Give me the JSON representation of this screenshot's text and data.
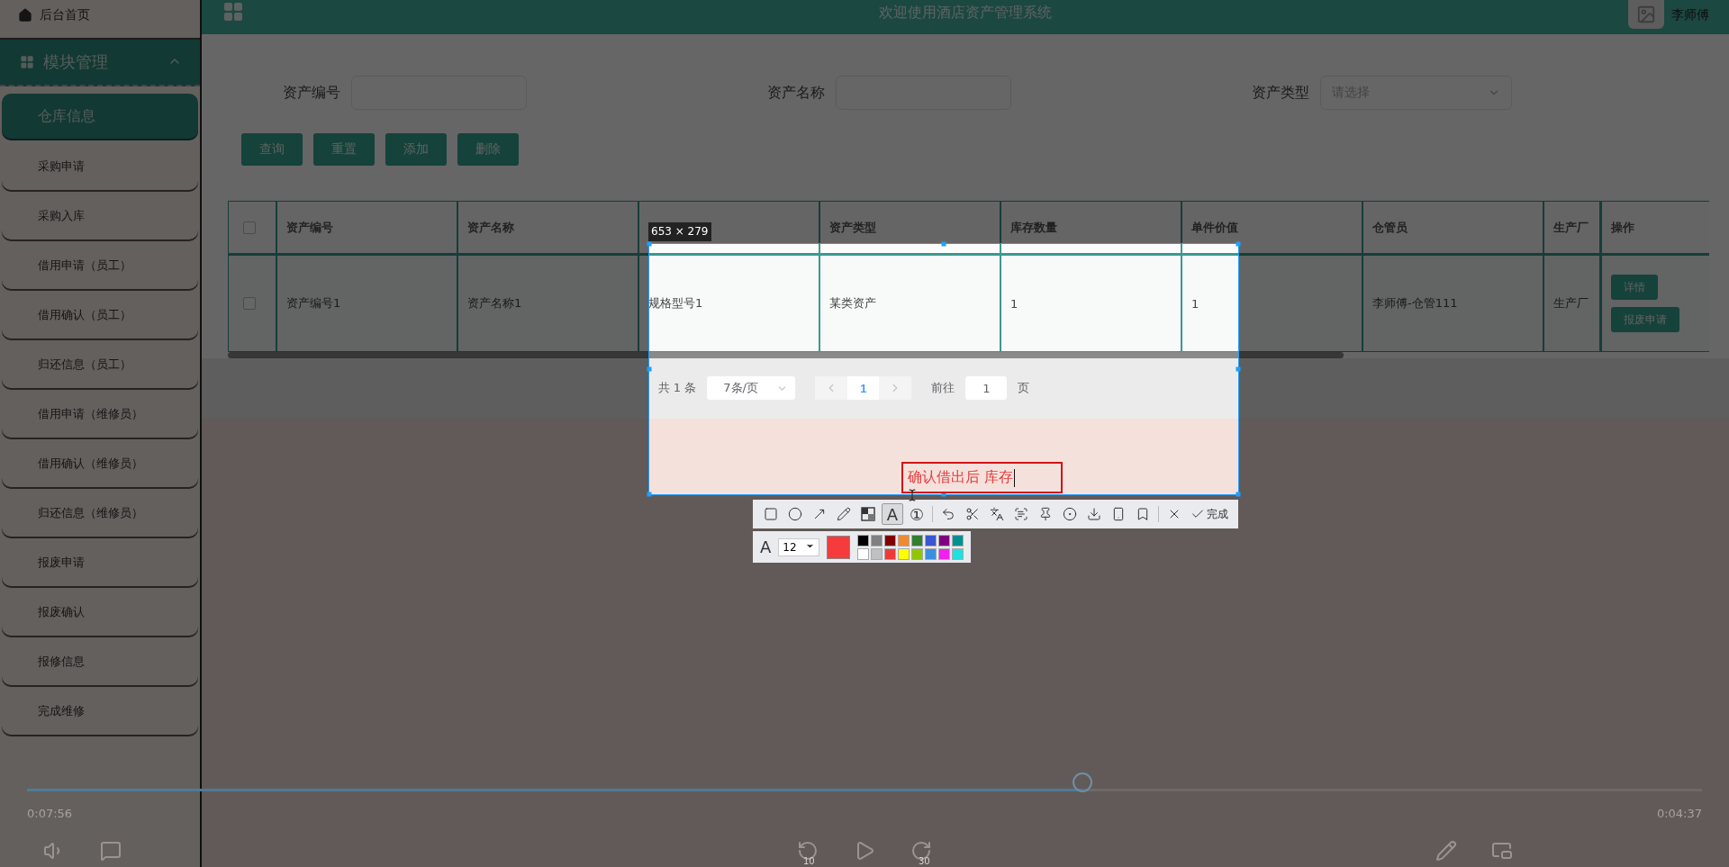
{
  "sidebar": {
    "home": "后台首页",
    "group": {
      "label": "模块管理",
      "expanded": true
    },
    "items": [
      {
        "label": "仓库信息",
        "selected": true
      },
      {
        "label": "采购申请",
        "selected": false
      },
      {
        "label": "采购入库",
        "selected": false
      },
      {
        "label": "借用申请（员工）",
        "selected": false
      },
      {
        "label": "借用确认（员工）",
        "selected": false
      },
      {
        "label": "归还信息（员工）",
        "selected": false
      },
      {
        "label": "借用申请（维修员）",
        "selected": false
      },
      {
        "label": "借用确认（维修员）",
        "selected": false
      },
      {
        "label": "归还信息（维修员）",
        "selected": false
      },
      {
        "label": "报废申请",
        "selected": false
      },
      {
        "label": "报废确认",
        "selected": false
      },
      {
        "label": "报修信息",
        "selected": false
      },
      {
        "label": "完成维修",
        "selected": false
      }
    ]
  },
  "header": {
    "title": "欢迎使用酒店资产管理系统",
    "user": "李师傅"
  },
  "search": {
    "fields": [
      {
        "label": "资产编号",
        "kind": "input"
      },
      {
        "label": "资产名称",
        "kind": "input"
      },
      {
        "label": "资产类型",
        "kind": "select",
        "placeholder": "请选择"
      }
    ],
    "buttons": [
      "查询",
      "重置",
      "添加",
      "删除"
    ]
  },
  "table": {
    "header_checked": false,
    "columns": [
      {
        "heading": "资产编号"
      },
      {
        "heading": "资产名称"
      },
      {},
      {
        "heading": "资产类型"
      },
      {
        "heading": "库存数量"
      },
      {
        "heading": "单件价值"
      },
      {
        "heading": "仓管员"
      },
      {
        "heading": "生产厂"
      }
    ],
    "action_heading": "操作",
    "rows": [
      {
        "checked": false,
        "cells": [
          "资产编号1",
          "资产名称1",
          "规格型号1",
          "某类资产",
          "1",
          "1",
          "李师傅-仓管111",
          "生产厂"
        ],
        "actions": [
          "详情",
          "报废申请"
        ]
      }
    ]
  },
  "pagination": {
    "total": "共 1 条",
    "page_size": "7条/页",
    "pages": [
      {
        "label": "1",
        "selected": true
      }
    ],
    "goto_label": "前往",
    "goto_value": "1",
    "goto_suffix": "页"
  },
  "capture": {
    "size": "653 × 279",
    "annotation": "确认借出后 库存",
    "tools": [
      [
        {
          "kind": "rect",
          "selected": false
        },
        {
          "kind": "ellipse",
          "selected": false
        },
        {
          "kind": "arrow",
          "selected": false
        },
        {
          "kind": "pencil",
          "selected": false
        },
        {
          "kind": "mosaic",
          "selected": false
        },
        {
          "kind": "text",
          "glyph": "A",
          "selected": true
        },
        {
          "kind": "number",
          "glyph": "①",
          "selected": false
        }
      ],
      [
        {
          "kind": "undo",
          "selected": false
        },
        {
          "kind": "cut",
          "selected": false
        },
        {
          "kind": "translate",
          "selected": false
        },
        {
          "kind": "scan",
          "selected": false
        },
        {
          "kind": "pin",
          "selected": false
        },
        {
          "kind": "record",
          "selected": false
        },
        {
          "kind": "download",
          "selected": false
        },
        {
          "kind": "phone",
          "selected": false
        },
        {
          "kind": "bookmark",
          "selected": false
        }
      ],
      [
        {
          "kind": "close",
          "selected": false
        },
        {
          "kind": "done",
          "label": "完成",
          "selected": false
        }
      ]
    ],
    "style_glyph": "A",
    "font_size": "12",
    "current_swatch": {
      "color": "#f53b3b"
    },
    "palette": [
      {
        "color": "#000000"
      },
      {
        "color": "#808080"
      },
      {
        "color": "#800000"
      },
      {
        "color": "#f08a30"
      },
      {
        "color": "#308030"
      },
      {
        "color": "#3a56d0"
      },
      {
        "color": "#800080"
      },
      {
        "color": "#009090"
      },
      {
        "color": "#ffffff"
      },
      {
        "color": "#c0c0c0"
      },
      {
        "color": "#f03a3a"
      },
      {
        "color": "#ffff00"
      },
      {
        "color": "#90c800"
      },
      {
        "color": "#3a90e0"
      },
      {
        "color": "#f020f0"
      },
      {
        "color": "#20e0e0"
      }
    ]
  },
  "player": {
    "elapsed": "0:07:56",
    "remaining": "0:04:37",
    "progress": {
      "level": 0.63
    },
    "rewind": "10",
    "forward": "30"
  }
}
